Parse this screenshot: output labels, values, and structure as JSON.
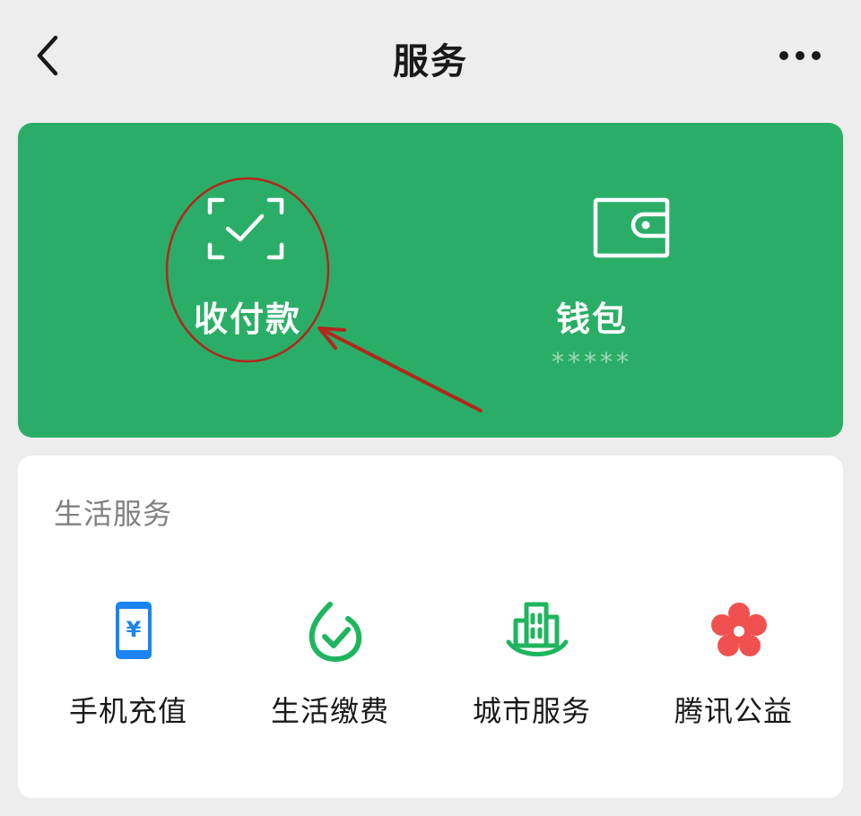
{
  "header": {
    "title": "服务"
  },
  "pay_card": {
    "background": "#2aae67",
    "pay": {
      "label": "收付款",
      "icon": "scan-check-icon"
    },
    "wallet": {
      "label": "钱包",
      "balance_masked": "*****",
      "icon": "wallet-icon"
    }
  },
  "life_services": {
    "title": "生活服务",
    "items": [
      {
        "label": "手机充值",
        "icon": "phone-recharge-icon",
        "color": "#1b84f0"
      },
      {
        "label": "生活缴费",
        "icon": "utility-payment-icon",
        "color": "#1fb55e"
      },
      {
        "label": "城市服务",
        "icon": "city-services-icon",
        "color": "#1fb55e"
      },
      {
        "label": "腾讯公益",
        "icon": "tencent-charity-icon",
        "color": "#f0504f"
      }
    ]
  },
  "annotation": {
    "color": "#b3261e"
  }
}
